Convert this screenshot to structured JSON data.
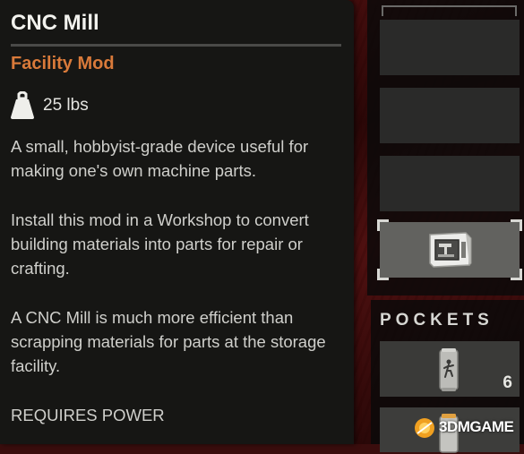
{
  "item": {
    "title": "CNC Mill",
    "category": "Facility Mod",
    "weight": "25 lbs",
    "description": [
      "A small, hobbyist-grade device useful for making one's own machine parts.",
      "Install this mod in a Workshop to convert building materials into parts for repair or crafting.",
      "A CNC Mill is much more efficient than scrapping materials for parts at the storage facility.",
      "REQUIRES POWER"
    ]
  },
  "inventory": {
    "selected_item_icon": "cnc-mill-icon"
  },
  "pockets": {
    "title": "POCKETS",
    "items": [
      {
        "icon": "energy-drink-can-icon",
        "count": "6"
      },
      {
        "icon": "soda-can-icon",
        "count": ""
      }
    ]
  },
  "watermark": {
    "text": "3DMGAME"
  },
  "colors": {
    "category_accent": "#d97a3a",
    "tooltip_bg": "#161614",
    "backdrop_red": "#3a0d0d"
  }
}
